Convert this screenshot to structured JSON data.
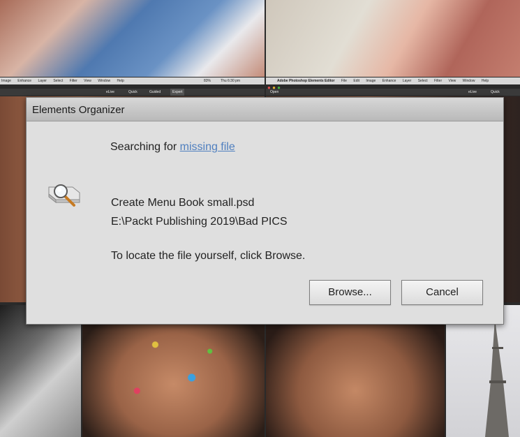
{
  "left_app": {
    "menu_items": [
      "Image",
      "Enhance",
      "Layer",
      "Select",
      "Filter",
      "View",
      "Window",
      "Help"
    ],
    "status_clock": "Thu 6:30 pm",
    "battery": "83%",
    "tabs": [
      "eLive",
      "Quick",
      "Guided",
      "Expert"
    ]
  },
  "right_app": {
    "app_name": "Adobe Photoshop Elements Editor",
    "menu_items": [
      "File",
      "Edit",
      "Image",
      "Enhance",
      "Layer",
      "Select",
      "Filter",
      "View",
      "Window",
      "Help"
    ],
    "open_label": "Open",
    "tabs": [
      "eLive",
      "Quick"
    ]
  },
  "dialog": {
    "title": "Elements Organizer",
    "searching_prefix": "Searching for",
    "searching_link": "missing file",
    "icon": "magnifier-drive-icon",
    "file_name": "Create Menu Book small.psd",
    "file_path": "E:\\Packt Publishing 2019\\Bad PICS",
    "instruction": "To locate the file yourself, click Browse.",
    "browse_label": "Browse...",
    "cancel_label": "Cancel"
  }
}
